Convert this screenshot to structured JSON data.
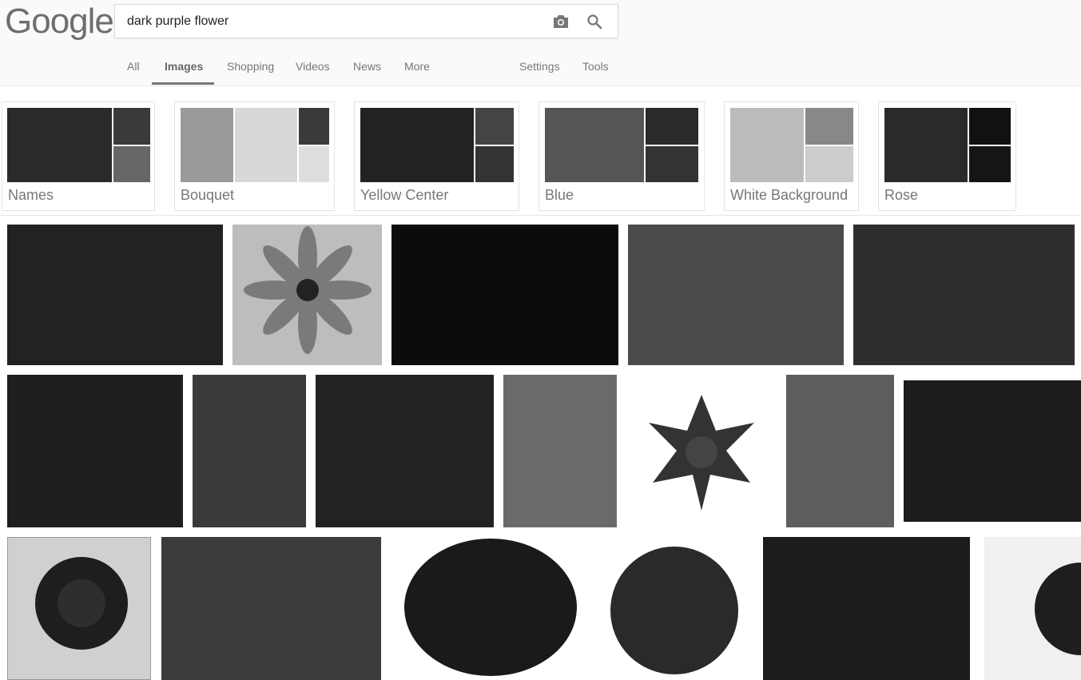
{
  "logo": {
    "text": "Google"
  },
  "search": {
    "query": "dark purple flower",
    "camera_icon": "camera-icon",
    "search_icon": "search-icon"
  },
  "tabs": [
    {
      "label": "All"
    },
    {
      "label": "Images",
      "active": true
    },
    {
      "label": "Shopping"
    },
    {
      "label": "Videos"
    },
    {
      "label": "News"
    },
    {
      "label": "More"
    },
    {
      "label": "Settings"
    },
    {
      "label": "Tools"
    }
  ],
  "chips": [
    {
      "label": "Names"
    },
    {
      "label": "Bouquet"
    },
    {
      "label": "Yellow Center"
    },
    {
      "label": "Blue"
    },
    {
      "label": "White Background"
    },
    {
      "label": "Rose"
    }
  ],
  "colors": {
    "text_grey": "#777777",
    "border": "#e4e4e4",
    "header_bg": "#fafafa"
  }
}
